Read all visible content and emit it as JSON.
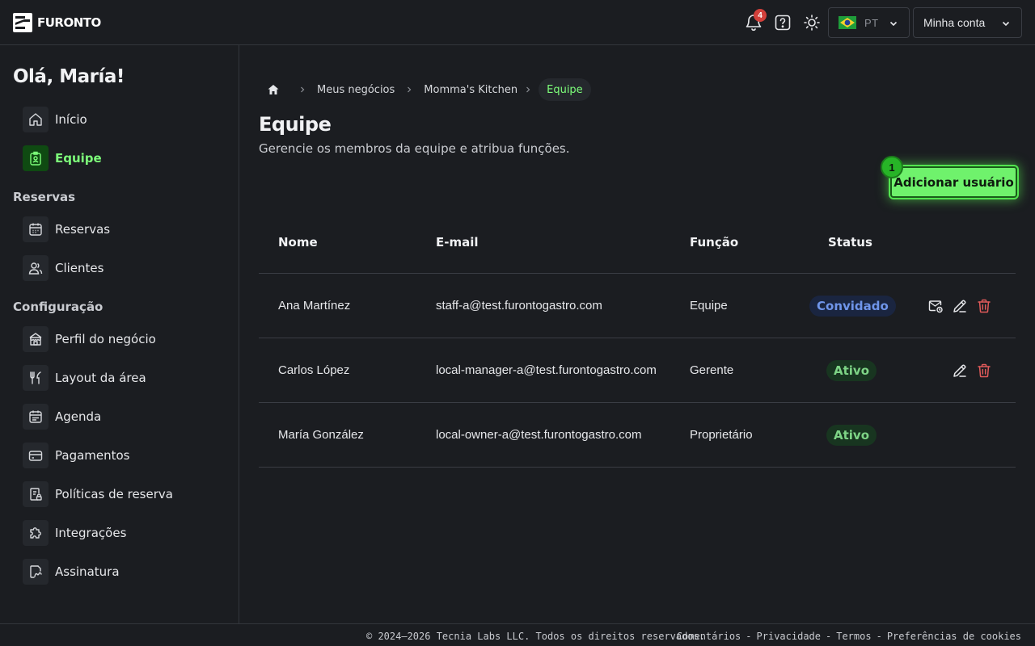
{
  "header": {
    "logo_text": "FURONTO",
    "notifications_count": "4",
    "language": {
      "code": "PT",
      "flag": "brazil-flag-icon"
    },
    "account_label": "Minha conta"
  },
  "sidebar": {
    "greeting": "Olá, María!",
    "items_top": [
      {
        "label": "Início",
        "icon": "home-icon"
      },
      {
        "label": "Equipe",
        "icon": "team-badge-icon",
        "active": true
      }
    ],
    "section_reservas": "Reservas",
    "items_reservas": [
      {
        "label": "Reservas",
        "icon": "calendar-icon"
      },
      {
        "label": "Clientes",
        "icon": "users-icon"
      }
    ],
    "section_config": "Configuração",
    "items_config": [
      {
        "label": "Perfil do negócio",
        "icon": "store-icon"
      },
      {
        "label": "Layout da área",
        "icon": "utensils-icon"
      },
      {
        "label": "Agenda",
        "icon": "schedule-icon"
      },
      {
        "label": "Pagamentos",
        "icon": "credit-card-icon"
      },
      {
        "label": "Políticas de reserva",
        "icon": "policy-lock-icon"
      },
      {
        "label": "Integrações",
        "icon": "puzzle-icon"
      },
      {
        "label": "Assinatura",
        "icon": "signature-icon"
      }
    ]
  },
  "breadcrumb": {
    "items": [
      "Meus negócios",
      "Momma's Kitchen",
      "Equipe"
    ]
  },
  "page": {
    "title": "Equipe",
    "subtitle": "Gerencie os membros da equipe e atribua funções.",
    "add_button": "Adicionar usuário",
    "step_badge": "1"
  },
  "table": {
    "headers": [
      "Nome",
      "E-mail",
      "Função",
      "Status"
    ],
    "rows": [
      {
        "name": "Ana Martínez",
        "email": "staff-a@test.furontogastro.com",
        "role": "Equipe",
        "status": "Convidado",
        "status_type": "invited",
        "actions": [
          "resend-invite-icon",
          "edit-icon",
          "delete-icon"
        ]
      },
      {
        "name": "Carlos López",
        "email": "local-manager-a@test.furontogastro.com",
        "role": "Gerente",
        "status": "Ativo",
        "status_type": "active",
        "actions": [
          "edit-icon",
          "delete-icon"
        ]
      },
      {
        "name": "María González",
        "email": "local-owner-a@test.furontogastro.com",
        "role": "Proprietário",
        "status": "Ativo",
        "status_type": "active",
        "actions": []
      }
    ]
  },
  "footer": {
    "copyright": "© 2024–2026 Tecnia Labs LLC. Todos os direitos reservados.",
    "links": [
      "Comentários",
      "Privacidade",
      "Termos",
      "Preferências de cookies"
    ],
    "separator": "-"
  },
  "colors": {
    "background": "#1b1d21",
    "accent_green": "#7dff7a",
    "button_green": "#6ff26c",
    "invited_blue": "#6f95ea",
    "delete_red": "#e05a5a"
  }
}
